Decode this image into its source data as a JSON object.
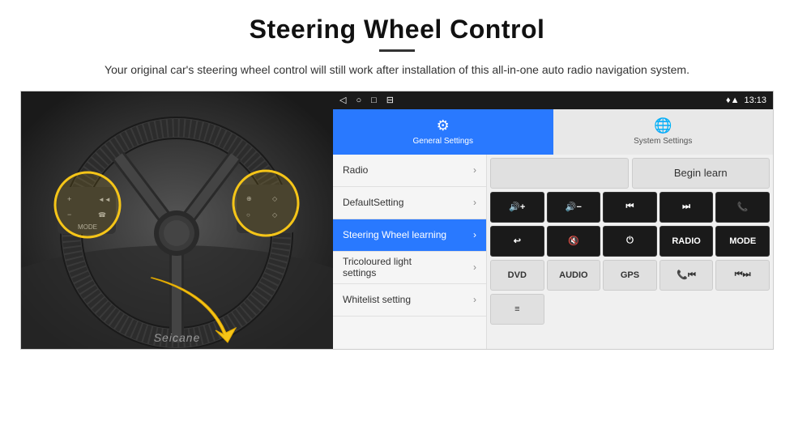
{
  "header": {
    "title": "Steering Wheel Control",
    "subtitle": "Your original car's steering wheel control will still work after installation of this all-in-one auto radio navigation system."
  },
  "status_bar": {
    "time": "13:13",
    "icons": [
      "◁",
      "○",
      "□",
      "⊟"
    ]
  },
  "tabs": [
    {
      "id": "general",
      "label": "General Settings",
      "icon": "⚙",
      "active": true
    },
    {
      "id": "system",
      "label": "System Settings",
      "icon": "🌐",
      "active": false
    }
  ],
  "menu": {
    "items": [
      {
        "label": "Radio",
        "active": false
      },
      {
        "label": "DefaultSetting",
        "active": false
      },
      {
        "label": "Steering Wheel learning",
        "active": true
      },
      {
        "label1": "Tricoloured light",
        "label2": "settings",
        "active": false,
        "two_line": true
      },
      {
        "label": "Whitelist setting",
        "active": false
      }
    ]
  },
  "controls": {
    "begin_learn_label": "Begin learn",
    "buttons_row1": [
      "🔊+",
      "🔊−",
      "⏮",
      "⏭",
      "📞"
    ],
    "buttons_row2": [
      "↩",
      "🔇",
      "⏻",
      "RADIO",
      "MODE"
    ],
    "buttons_row3": [
      "DVD",
      "AUDIO",
      "GPS",
      "📞⏮",
      "⏮⏭"
    ],
    "buttons_row4": [
      "≡"
    ]
  },
  "watermark": "Seicane"
}
